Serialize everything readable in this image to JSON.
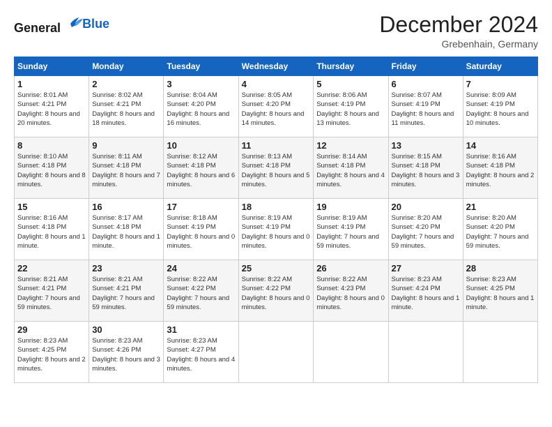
{
  "header": {
    "logo_line1": "General",
    "logo_line2": "Blue",
    "month_title": "December 2024",
    "location": "Grebenhain, Germany"
  },
  "days_of_week": [
    "Sunday",
    "Monday",
    "Tuesday",
    "Wednesday",
    "Thursday",
    "Friday",
    "Saturday"
  ],
  "weeks": [
    [
      {
        "day": "1",
        "sunrise": "8:01 AM",
        "sunset": "4:21 PM",
        "daylight": "8 hours and 20 minutes"
      },
      {
        "day": "2",
        "sunrise": "8:02 AM",
        "sunset": "4:21 PM",
        "daylight": "8 hours and 18 minutes"
      },
      {
        "day": "3",
        "sunrise": "8:04 AM",
        "sunset": "4:20 PM",
        "daylight": "8 hours and 16 minutes"
      },
      {
        "day": "4",
        "sunrise": "8:05 AM",
        "sunset": "4:20 PM",
        "daylight": "8 hours and 14 minutes"
      },
      {
        "day": "5",
        "sunrise": "8:06 AM",
        "sunset": "4:19 PM",
        "daylight": "8 hours and 13 minutes"
      },
      {
        "day": "6",
        "sunrise": "8:07 AM",
        "sunset": "4:19 PM",
        "daylight": "8 hours and 11 minutes"
      },
      {
        "day": "7",
        "sunrise": "8:09 AM",
        "sunset": "4:19 PM",
        "daylight": "8 hours and 10 minutes"
      }
    ],
    [
      {
        "day": "8",
        "sunrise": "8:10 AM",
        "sunset": "4:18 PM",
        "daylight": "8 hours and 8 minutes"
      },
      {
        "day": "9",
        "sunrise": "8:11 AM",
        "sunset": "4:18 PM",
        "daylight": "8 hours and 7 minutes"
      },
      {
        "day": "10",
        "sunrise": "8:12 AM",
        "sunset": "4:18 PM",
        "daylight": "8 hours and 6 minutes"
      },
      {
        "day": "11",
        "sunrise": "8:13 AM",
        "sunset": "4:18 PM",
        "daylight": "8 hours and 5 minutes"
      },
      {
        "day": "12",
        "sunrise": "8:14 AM",
        "sunset": "4:18 PM",
        "daylight": "8 hours and 4 minutes"
      },
      {
        "day": "13",
        "sunrise": "8:15 AM",
        "sunset": "4:18 PM",
        "daylight": "8 hours and 3 minutes"
      },
      {
        "day": "14",
        "sunrise": "8:16 AM",
        "sunset": "4:18 PM",
        "daylight": "8 hours and 2 minutes"
      }
    ],
    [
      {
        "day": "15",
        "sunrise": "8:16 AM",
        "sunset": "4:18 PM",
        "daylight": "8 hours and 1 minute"
      },
      {
        "day": "16",
        "sunrise": "8:17 AM",
        "sunset": "4:18 PM",
        "daylight": "8 hours and 1 minute"
      },
      {
        "day": "17",
        "sunrise": "8:18 AM",
        "sunset": "4:19 PM",
        "daylight": "8 hours and 0 minutes"
      },
      {
        "day": "18",
        "sunrise": "8:19 AM",
        "sunset": "4:19 PM",
        "daylight": "8 hours and 0 minutes"
      },
      {
        "day": "19",
        "sunrise": "8:19 AM",
        "sunset": "4:19 PM",
        "daylight": "7 hours and 59 minutes"
      },
      {
        "day": "20",
        "sunrise": "8:20 AM",
        "sunset": "4:20 PM",
        "daylight": "7 hours and 59 minutes"
      },
      {
        "day": "21",
        "sunrise": "8:20 AM",
        "sunset": "4:20 PM",
        "daylight": "7 hours and 59 minutes"
      }
    ],
    [
      {
        "day": "22",
        "sunrise": "8:21 AM",
        "sunset": "4:21 PM",
        "daylight": "7 hours and 59 minutes"
      },
      {
        "day": "23",
        "sunrise": "8:21 AM",
        "sunset": "4:21 PM",
        "daylight": "7 hours and 59 minutes"
      },
      {
        "day": "24",
        "sunrise": "8:22 AM",
        "sunset": "4:22 PM",
        "daylight": "7 hours and 59 minutes"
      },
      {
        "day": "25",
        "sunrise": "8:22 AM",
        "sunset": "4:22 PM",
        "daylight": "8 hours and 0 minutes"
      },
      {
        "day": "26",
        "sunrise": "8:22 AM",
        "sunset": "4:23 PM",
        "daylight": "8 hours and 0 minutes"
      },
      {
        "day": "27",
        "sunrise": "8:23 AM",
        "sunset": "4:24 PM",
        "daylight": "8 hours and 1 minute"
      },
      {
        "day": "28",
        "sunrise": "8:23 AM",
        "sunset": "4:25 PM",
        "daylight": "8 hours and 1 minute"
      }
    ],
    [
      {
        "day": "29",
        "sunrise": "8:23 AM",
        "sunset": "4:25 PM",
        "daylight": "8 hours and 2 minutes"
      },
      {
        "day": "30",
        "sunrise": "8:23 AM",
        "sunset": "4:26 PM",
        "daylight": "8 hours and 3 minutes"
      },
      {
        "day": "31",
        "sunrise": "8:23 AM",
        "sunset": "4:27 PM",
        "daylight": "8 hours and 4 minutes"
      },
      null,
      null,
      null,
      null
    ]
  ]
}
